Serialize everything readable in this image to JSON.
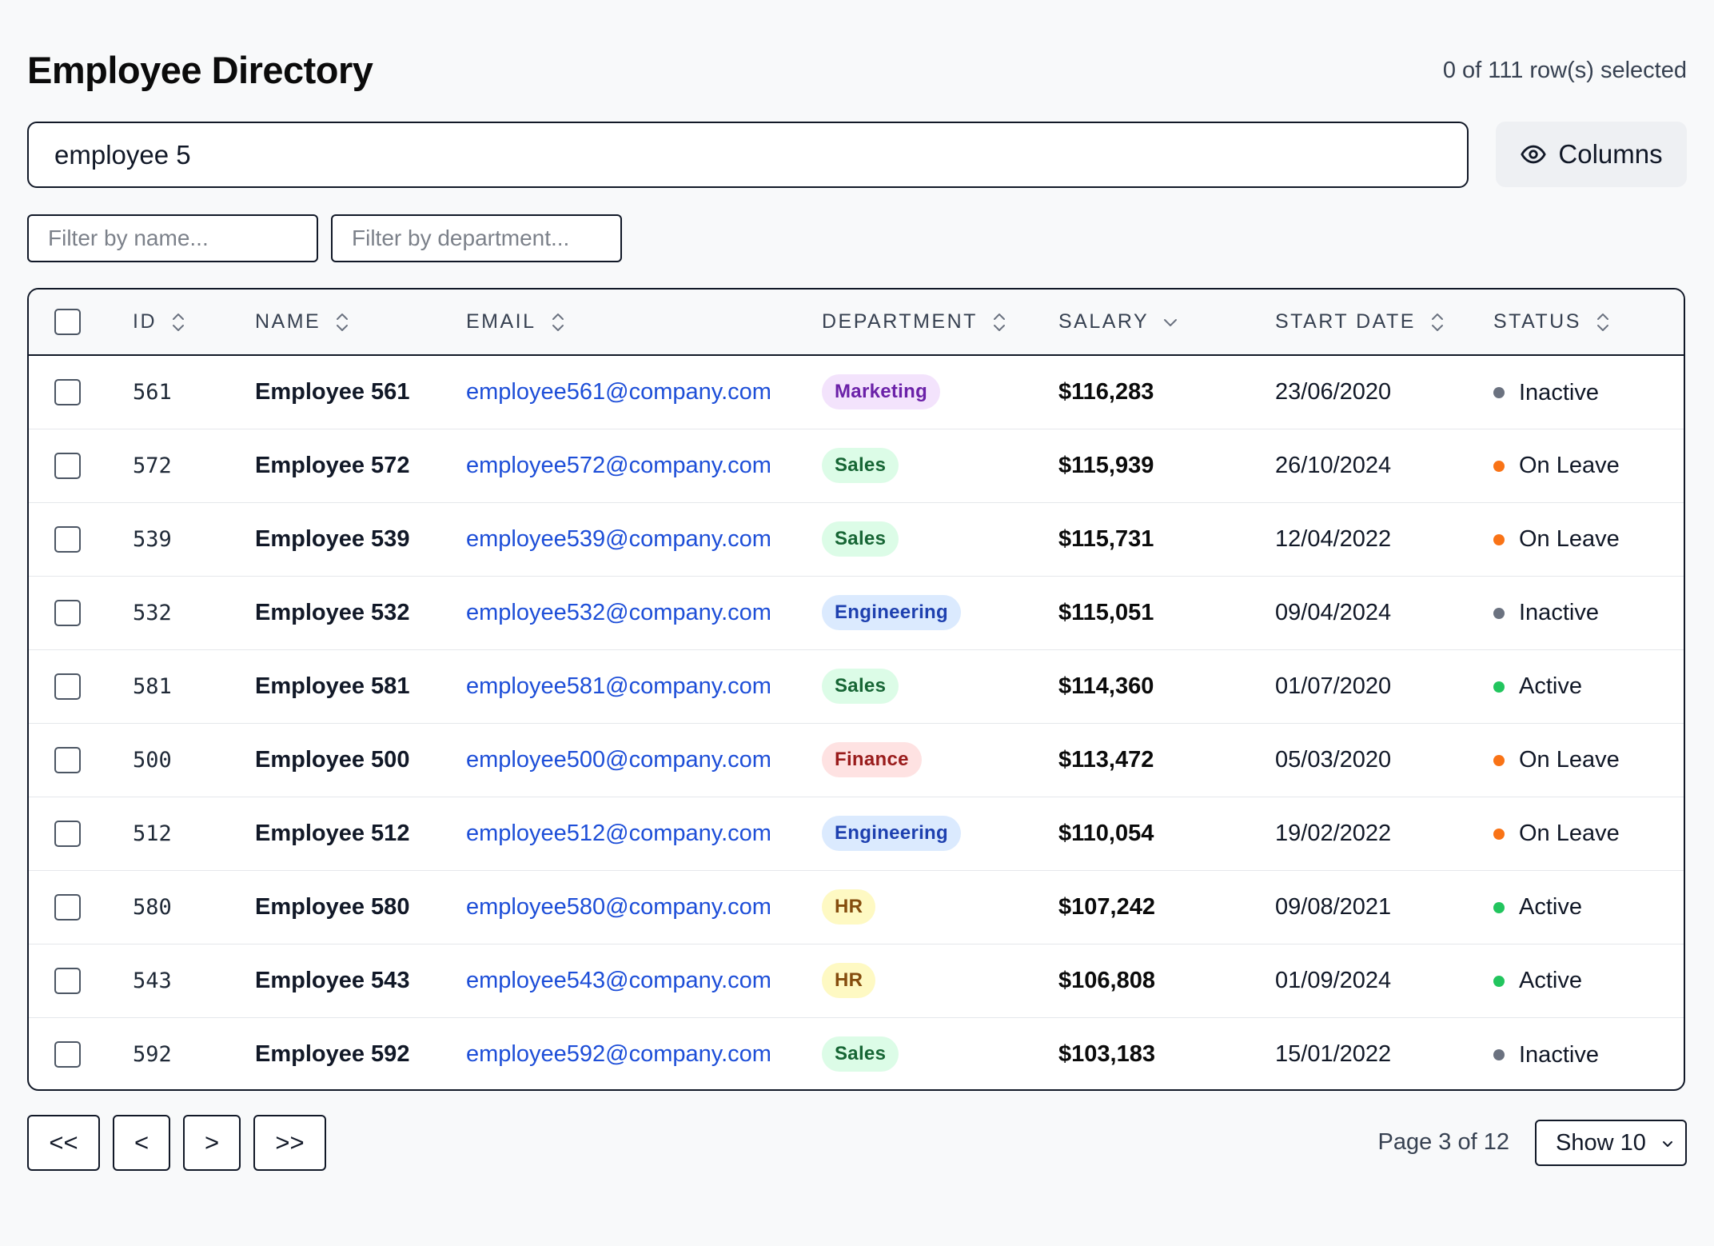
{
  "header": {
    "title": "Employee Directory",
    "selected_text": "0 of 111 row(s) selected"
  },
  "search": {
    "value": "employee 5",
    "columns_label": "Columns"
  },
  "filters": {
    "name_placeholder": "Filter by name...",
    "department_placeholder": "Filter by department..."
  },
  "table": {
    "columns": [
      "ID",
      "NAME",
      "EMAIL",
      "DEPARTMENT",
      "SALARY",
      "START DATE",
      "STATUS"
    ],
    "rows": [
      {
        "id": "561",
        "name": "Employee 561",
        "email": "employee561@company.com",
        "department": "Marketing",
        "salary": "$116,283",
        "start_date": "23/06/2020",
        "status": "Inactive"
      },
      {
        "id": "572",
        "name": "Employee 572",
        "email": "employee572@company.com",
        "department": "Sales",
        "salary": "$115,939",
        "start_date": "26/10/2024",
        "status": "On Leave"
      },
      {
        "id": "539",
        "name": "Employee 539",
        "email": "employee539@company.com",
        "department": "Sales",
        "salary": "$115,731",
        "start_date": "12/04/2022",
        "status": "On Leave"
      },
      {
        "id": "532",
        "name": "Employee 532",
        "email": "employee532@company.com",
        "department": "Engineering",
        "salary": "$115,051",
        "start_date": "09/04/2024",
        "status": "Inactive"
      },
      {
        "id": "581",
        "name": "Employee 581",
        "email": "employee581@company.com",
        "department": "Sales",
        "salary": "$114,360",
        "start_date": "01/07/2020",
        "status": "Active"
      },
      {
        "id": "500",
        "name": "Employee 500",
        "email": "employee500@company.com",
        "department": "Finance",
        "salary": "$113,472",
        "start_date": "05/03/2020",
        "status": "On Leave"
      },
      {
        "id": "512",
        "name": "Employee 512",
        "email": "employee512@company.com",
        "department": "Engineering",
        "salary": "$110,054",
        "start_date": "19/02/2022",
        "status": "On Leave"
      },
      {
        "id": "580",
        "name": "Employee 580",
        "email": "employee580@company.com",
        "department": "HR",
        "salary": "$107,242",
        "start_date": "09/08/2021",
        "status": "Active"
      },
      {
        "id": "543",
        "name": "Employee 543",
        "email": "employee543@company.com",
        "department": "HR",
        "salary": "$106,808",
        "start_date": "01/09/2024",
        "status": "Active"
      },
      {
        "id": "592",
        "name": "Employee 592",
        "email": "employee592@company.com",
        "department": "Sales",
        "salary": "$103,183",
        "start_date": "15/01/2022",
        "status": "Inactive"
      }
    ]
  },
  "department_colors": {
    "Marketing": {
      "bg": "#f3e3fc",
      "fg": "#6b21a8"
    },
    "Sales": {
      "bg": "#dcfce7",
      "fg": "#166534"
    },
    "Engineering": {
      "bg": "#dbeafe",
      "fg": "#1e40af"
    },
    "Finance": {
      "bg": "#fee2e2",
      "fg": "#991b1b"
    },
    "HR": {
      "bg": "#fef9c3",
      "fg": "#854d0e"
    }
  },
  "status_colors": {
    "Active": "#22c55e",
    "On Leave": "#f97316",
    "Inactive": "#6b7280"
  },
  "pagination": {
    "first_label": "<<",
    "prev_label": "<",
    "next_label": ">",
    "last_label": ">>",
    "page_info": "Page 3 of 12",
    "page_size_label": "Show 10"
  }
}
